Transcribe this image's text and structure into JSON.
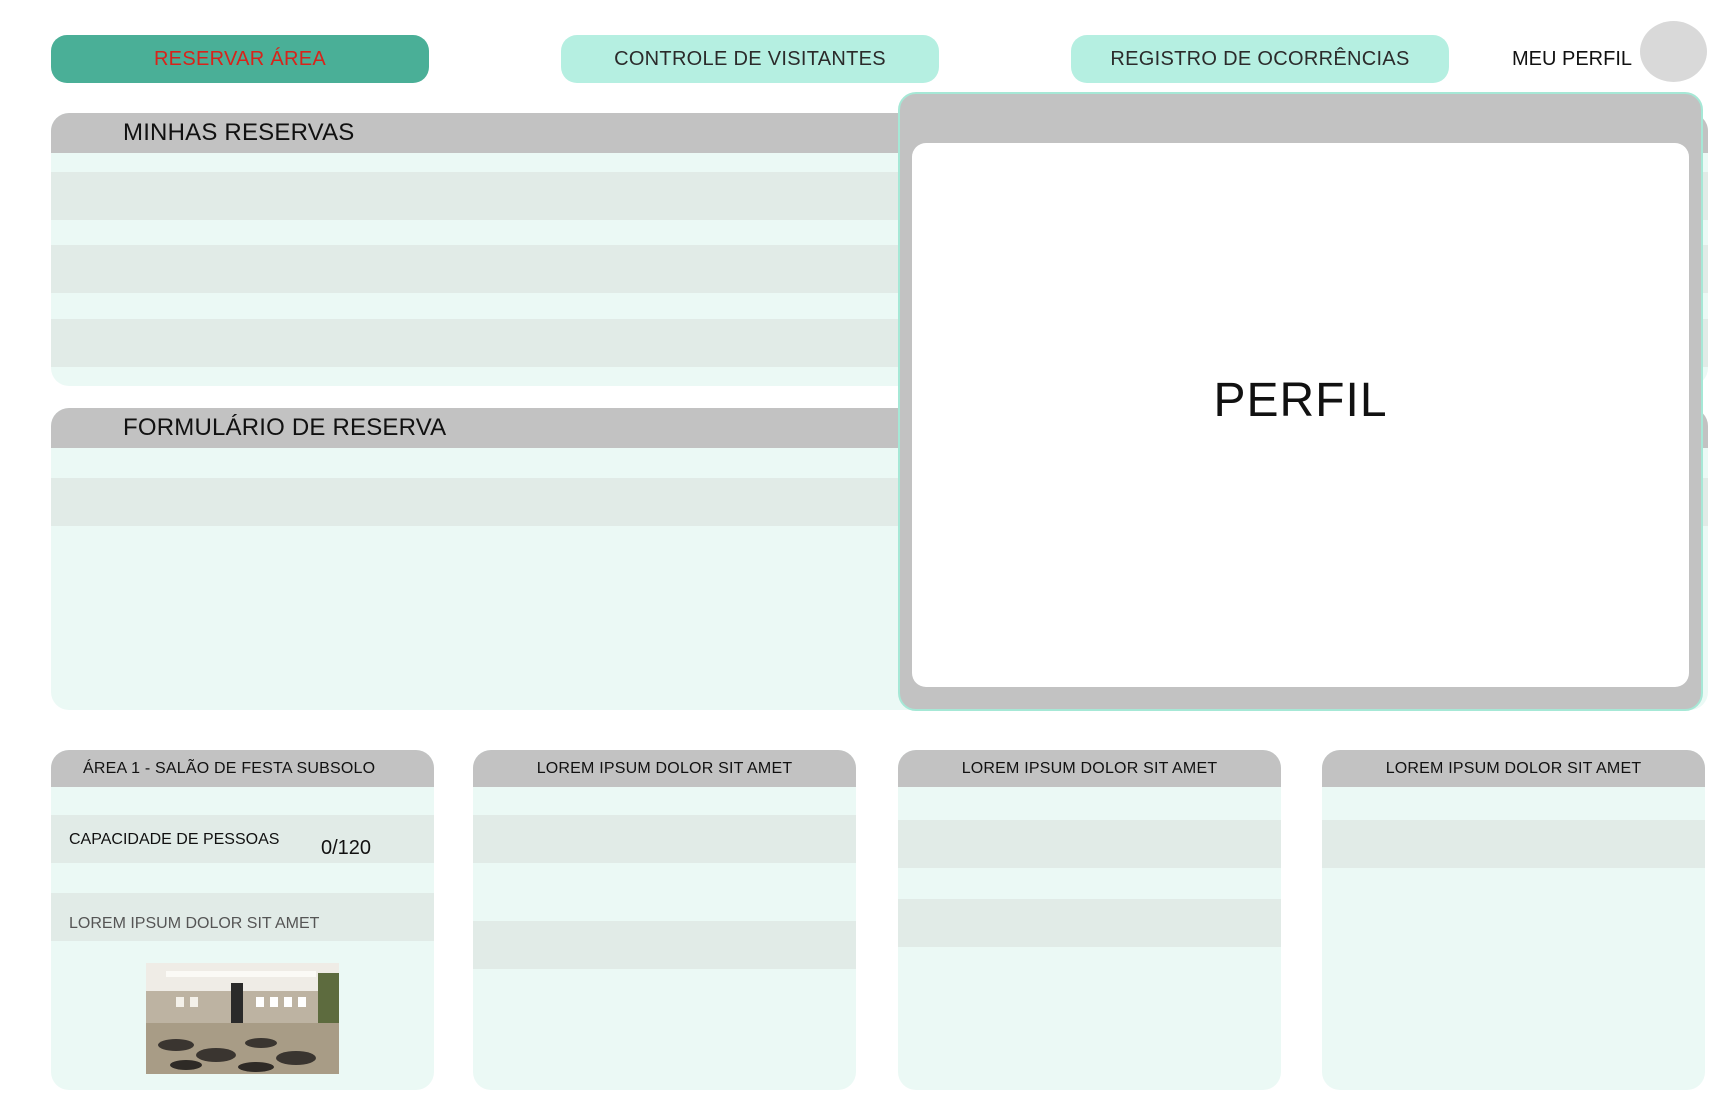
{
  "nav": {
    "reservar": "RESERVAR ÁREA",
    "visitantes": "CONTROLE DE VISITANTES",
    "ocorrencias": "REGISTRO DE OCORRÊNCIAS",
    "perfil": "MEU PERFIL"
  },
  "panels": {
    "reservas_title": "MINHAS RESERVAS",
    "formulario_title": "FORMULÁRIO DE RESERVA"
  },
  "overlay": {
    "title": "PERFIL"
  },
  "cards": [
    {
      "title": "ÁREA 1 - SALÃO DE FESTA SUBSOLO",
      "capacity_label": "CAPACIDADE DE PESSOAS",
      "capacity_value": "0/120",
      "line": "LOREM IPSUM DOLOR SIT AMET"
    },
    {
      "title": "LOREM IPSUM DOLOR SIT AMET"
    },
    {
      "title": "LOREM IPSUM DOLOR SIT AMET"
    },
    {
      "title": "LOREM IPSUM DOLOR SIT AMET"
    }
  ],
  "colors": {
    "accent": "#4aaf97",
    "accent_text": "#d8231a",
    "nav_light": "#b5efe1",
    "panel_bg": "#ebf9f5",
    "row_bg": "#e1ebe7",
    "header_gray": "#c2c2c2"
  }
}
